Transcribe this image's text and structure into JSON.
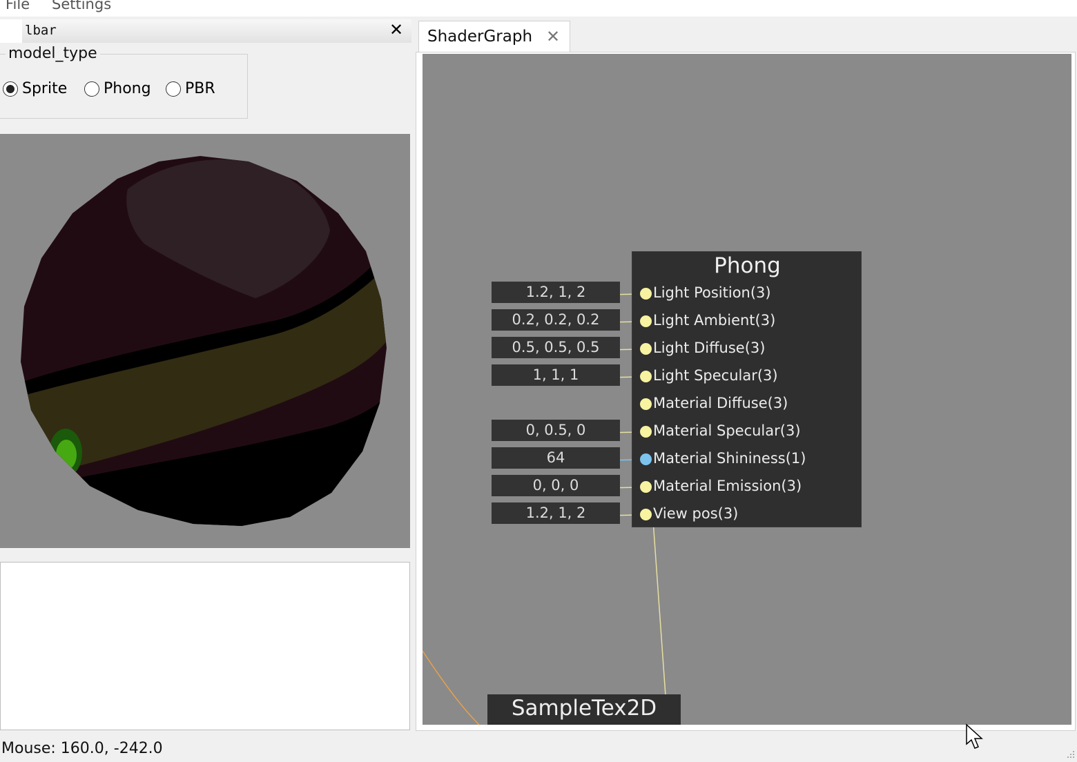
{
  "menu": {
    "file": "File",
    "settings": "Settings"
  },
  "dock": {
    "title": "lbar",
    "close": "✕",
    "group_title": "model_type",
    "radios": [
      {
        "label": "Sprite",
        "checked": true
      },
      {
        "label": "Phong",
        "checked": false
      },
      {
        "label": "PBR",
        "checked": false
      }
    ]
  },
  "tab": {
    "label": "ShaderGraph",
    "close": "✕"
  },
  "graph": {
    "node_title": "Phong",
    "ports": [
      {
        "label": "Light Position(3)",
        "value": "1.2, 1, 2",
        "color": "#f7f3a0"
      },
      {
        "label": "Light Ambient(3)",
        "value": "0.2, 0.2, 0.2",
        "color": "#f7f3a0"
      },
      {
        "label": "Light Diffuse(3)",
        "value": "0.5, 0.5, 0.5",
        "color": "#f7f3a0"
      },
      {
        "label": "Light Specular(3)",
        "value": "1, 1, 1",
        "color": "#f7f3a0"
      },
      {
        "label": "Material Diffuse(3)",
        "value": "",
        "color": "#f7f3a0"
      },
      {
        "label": "Material Specular(3)",
        "value": "0, 0.5, 0",
        "color": "#f7f3a0"
      },
      {
        "label": "Material Shininess(1)",
        "value": "64",
        "color": "#7cc4ee"
      },
      {
        "label": "Material Emission(3)",
        "value": "0, 0, 0",
        "color": "#f7f3a0"
      },
      {
        "label": "View pos(3)",
        "value": "1.2, 1, 2",
        "color": "#f7f3a0"
      }
    ],
    "sample_node_title": "SampleTex2D"
  },
  "status": {
    "mouse": "Mouse: 160.0, -242.0"
  }
}
